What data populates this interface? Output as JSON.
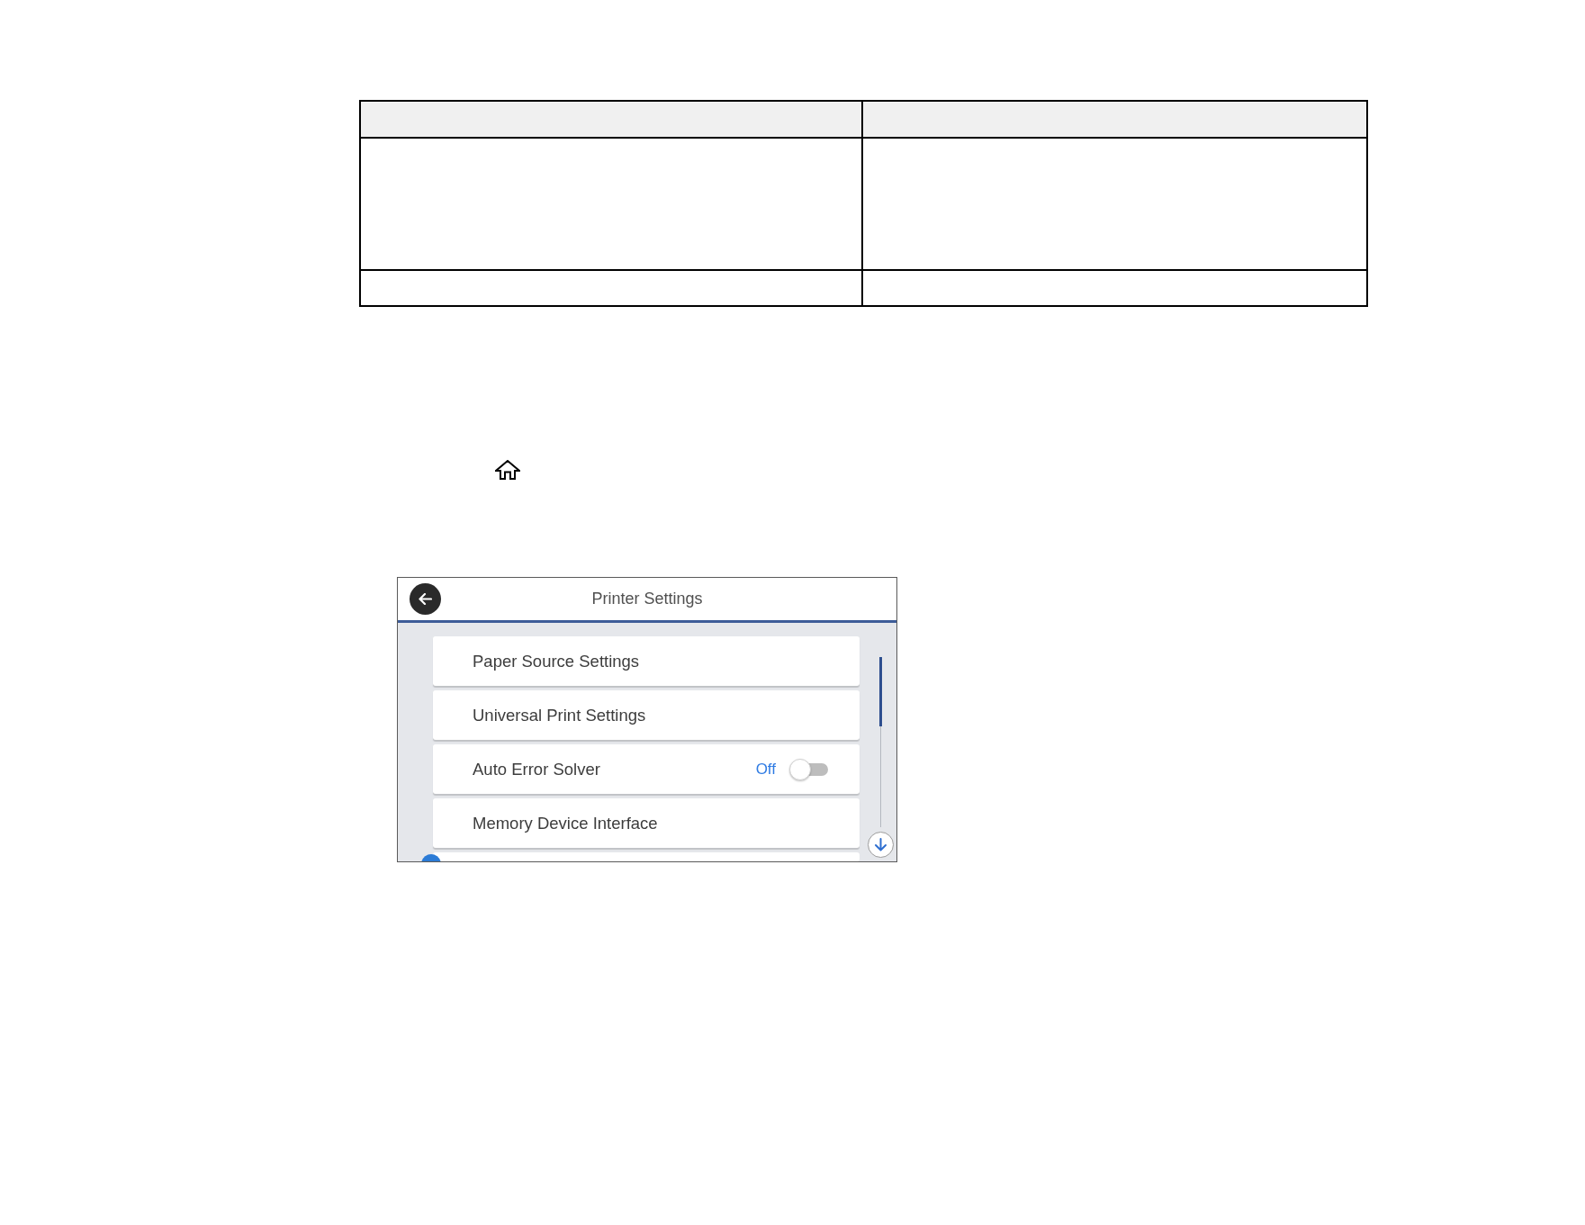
{
  "table": {
    "rows": [
      {
        "kind": "header"
      },
      {
        "kind": "body"
      },
      {
        "kind": "body"
      }
    ]
  },
  "printer_screen": {
    "title": "Printer Settings",
    "items": [
      {
        "kind": "link",
        "label": "Paper Source Settings"
      },
      {
        "kind": "link",
        "label": "Universal Print Settings"
      },
      {
        "kind": "toggle",
        "label": "Auto Error Solver",
        "value": "Off",
        "on": false
      },
      {
        "kind": "link",
        "label": "Memory Device Interface"
      },
      {
        "kind": "link"
      }
    ]
  }
}
